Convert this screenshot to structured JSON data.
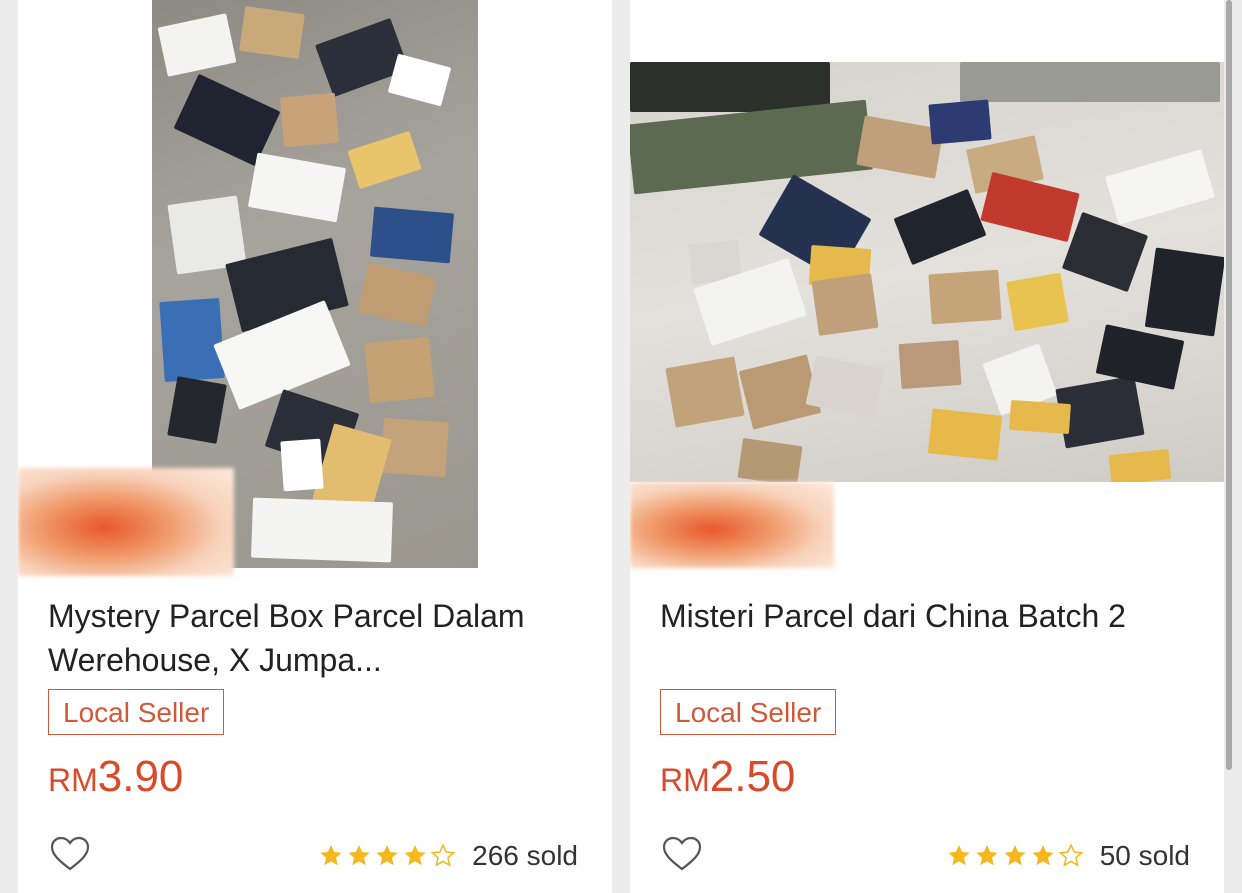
{
  "products": [
    {
      "title": "Mystery Parcel Box Parcel Dalam Werehouse, X Jumpa...",
      "seller_tag": "Local Seller",
      "price_currency": "RM",
      "price_amount": "3.90",
      "rating": 4,
      "sold": "266 sold"
    },
    {
      "title": "Misteri Parcel dari China Batch 2",
      "seller_tag": "Local Seller",
      "price_currency": "RM",
      "price_amount": "2.50",
      "rating": 4,
      "sold": "50 sold"
    }
  ],
  "colors": {
    "accent": "#d9492a",
    "star": "#f5b81c"
  },
  "icons": {
    "favorite": "heart-outline-icon",
    "star_full": "star-filled-icon",
    "star_empty": "star-outline-icon"
  }
}
